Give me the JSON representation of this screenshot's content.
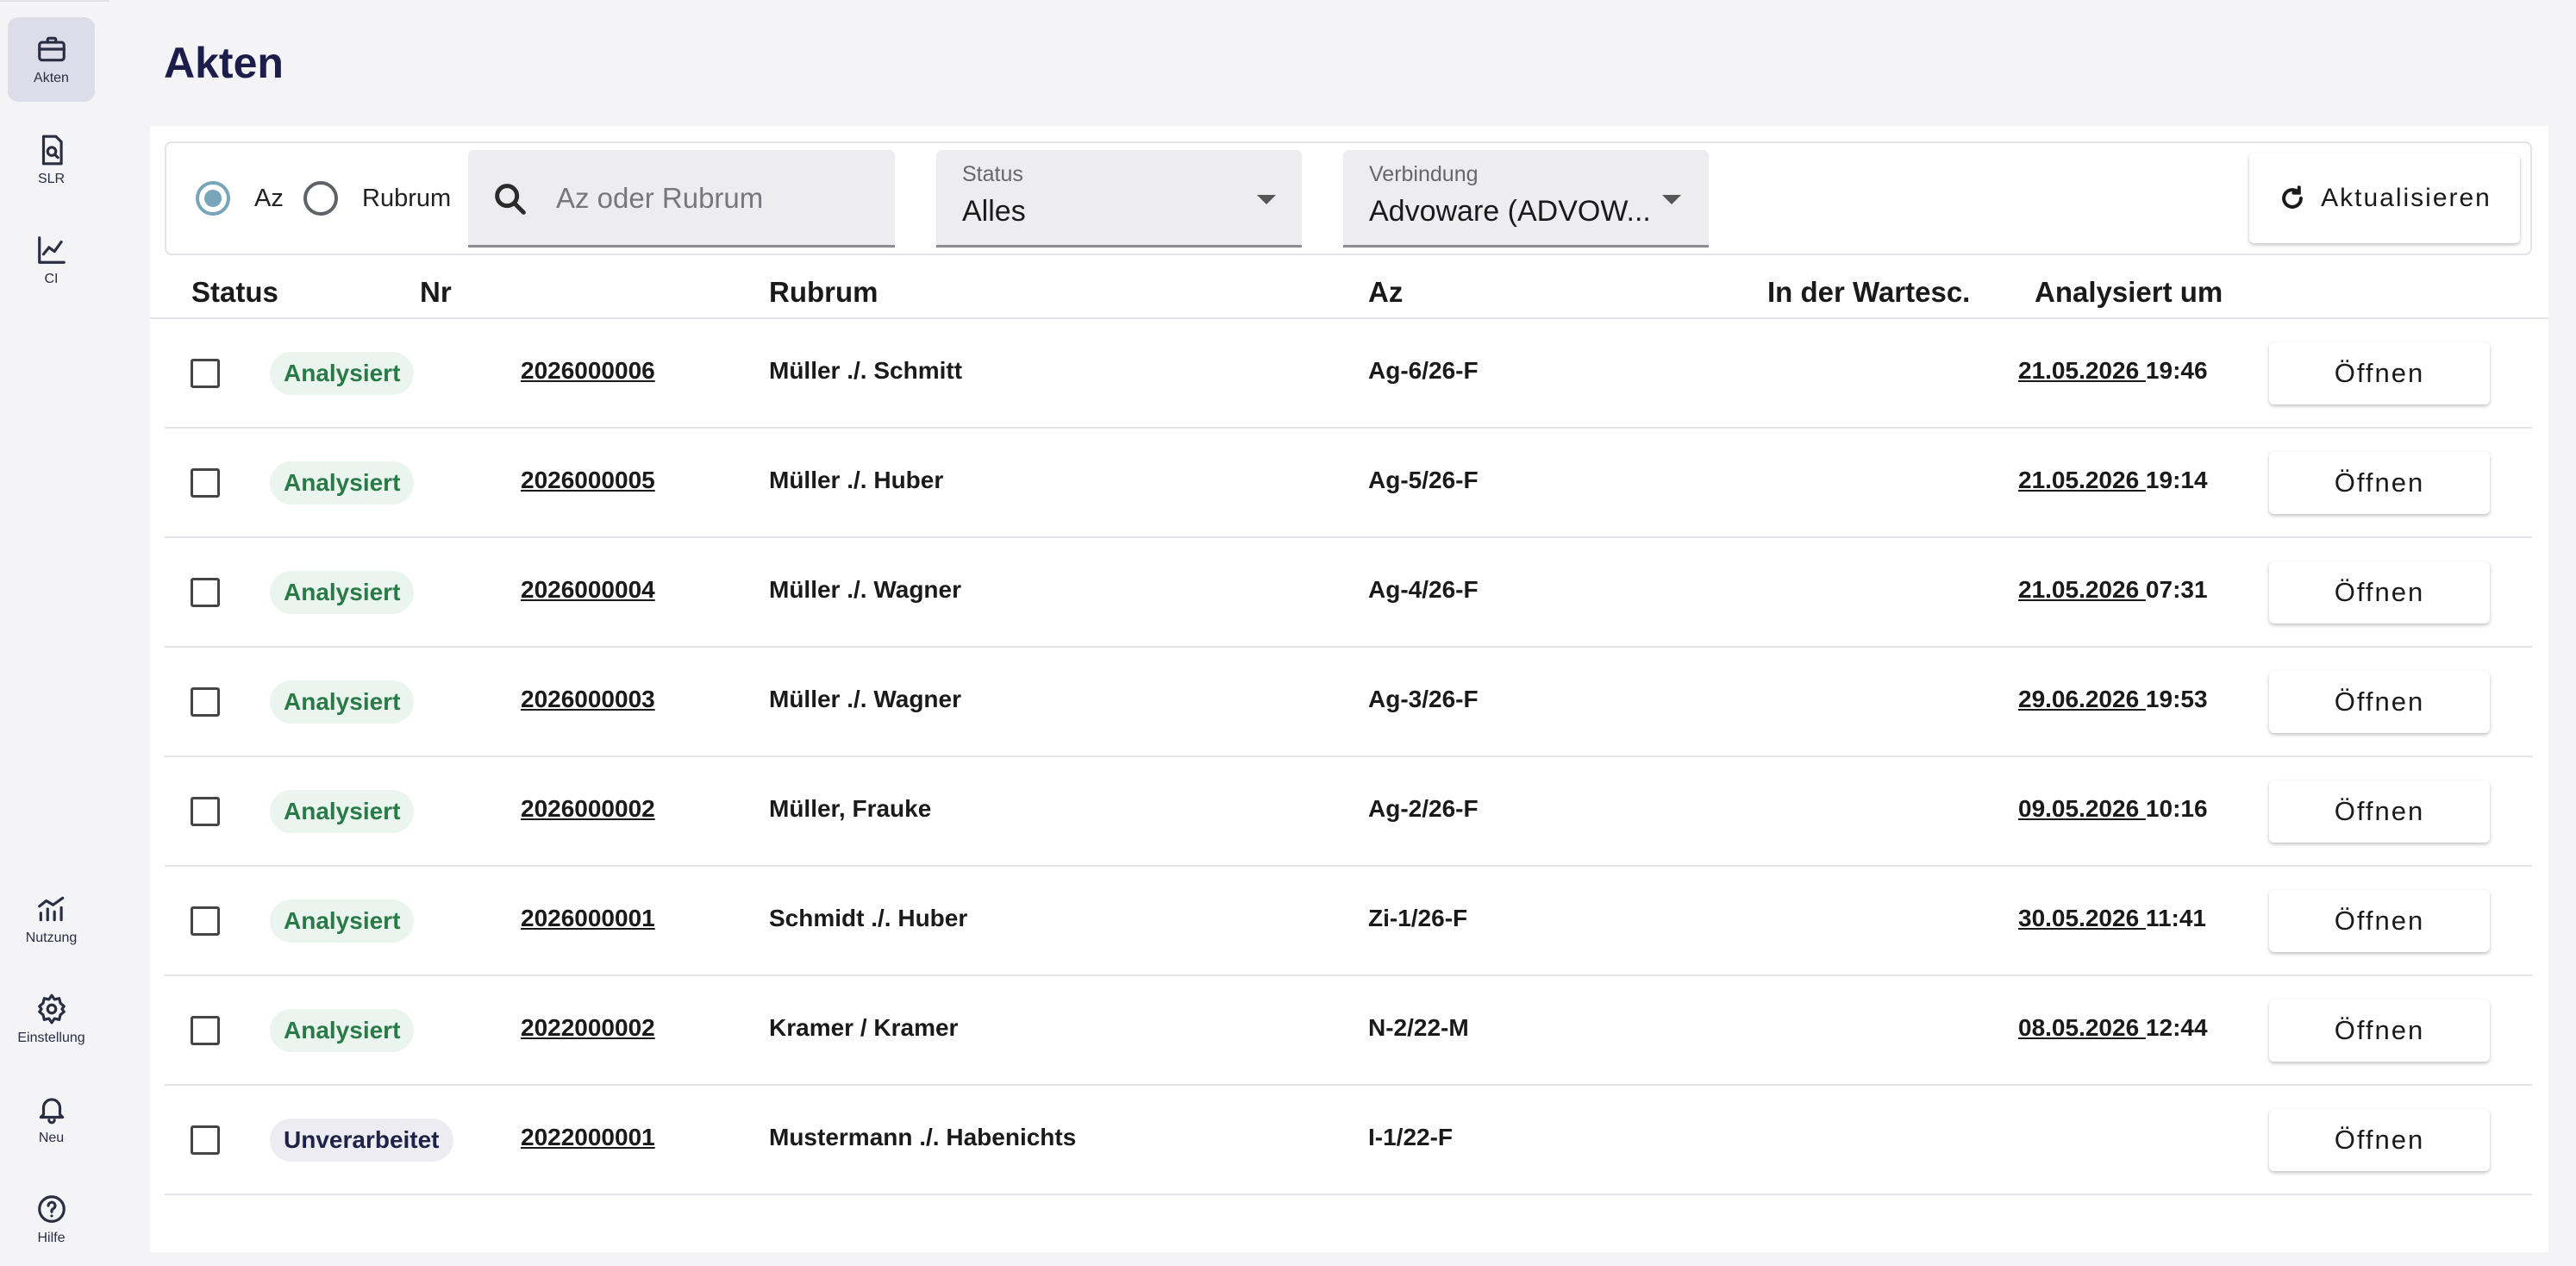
{
  "sidebar": {
    "items": [
      {
        "label": "Akten",
        "icon": "briefcase-icon"
      },
      {
        "label": "SLR",
        "icon": "document-search-icon"
      },
      {
        "label": "CI",
        "icon": "line-chart-icon"
      },
      {
        "label": "Nutzung",
        "icon": "usage-chart-icon"
      },
      {
        "label": "Einstellung",
        "icon": "gear-icon"
      },
      {
        "label": "Neu",
        "icon": "bell-icon"
      },
      {
        "label": "Hilfe",
        "icon": "help-circle-icon"
      }
    ]
  },
  "page": {
    "title": "Akten"
  },
  "filters": {
    "radio_az": "Az",
    "radio_rubrum": "Rubrum",
    "search_placeholder": "Az oder Rubrum",
    "status_label": "Status",
    "status_value": "Alles",
    "verbindung_label": "Verbindung",
    "verbindung_value": "Advoware (ADVOW...",
    "refresh_label": "Aktualisieren"
  },
  "table": {
    "headers": {
      "status": "Status",
      "nr": "Nr",
      "rubrum": "Rubrum",
      "az": "Az",
      "queue": "In der Wartesc.",
      "analyzed": "Analysiert um"
    },
    "open_label": "Öffnen",
    "rows": [
      {
        "status": "Analysiert",
        "nr": "2026000006",
        "rubrum": "Müller ./. Schmitt",
        "az": "Ag-6/26-F",
        "date": "21.05.2026 ",
        "time": "19:46"
      },
      {
        "status": "Analysiert",
        "nr": "2026000005",
        "rubrum": "Müller ./. Huber",
        "az": "Ag-5/26-F",
        "date": "21.05.2026 ",
        "time": "19:14"
      },
      {
        "status": "Analysiert",
        "nr": "2026000004",
        "rubrum": "Müller ./. Wagner",
        "az": "Ag-4/26-F",
        "date": "21.05.2026 ",
        "time": "07:31"
      },
      {
        "status": "Analysiert",
        "nr": "2026000003",
        "rubrum": "Müller ./. Wagner",
        "az": "Ag-3/26-F",
        "date": "29.06.2026 ",
        "time": "19:53"
      },
      {
        "status": "Analysiert",
        "nr": "2026000002",
        "rubrum": "Müller, Frauke",
        "az": "Ag-2/26-F",
        "date": "09.05.2026 ",
        "time": "10:16"
      },
      {
        "status": "Analysiert",
        "nr": "2026000001",
        "rubrum": "Schmidt ./. Huber",
        "az": "Zi-1/26-F",
        "date": "30.05.2026 ",
        "time": "11:41"
      },
      {
        "status": "Analysiert",
        "nr": "2022000002",
        "rubrum": "Kramer / Kramer",
        "az": "N-2/22-M",
        "date": "08.05.2026 ",
        "time": "12:44"
      },
      {
        "status": "Unverarbeitet",
        "nr": "2022000001",
        "rubrum": "Mustermann ./. Habenichts",
        "az": "I-1/22-F",
        "date": "",
        "time": ""
      }
    ]
  }
}
